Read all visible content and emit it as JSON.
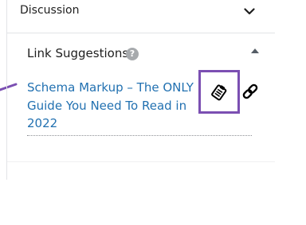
{
  "discussion": {
    "title": "Discussion",
    "chevron_icon": "chevron-down-icon"
  },
  "link_suggestions": {
    "title": "Link Suggestions",
    "help_glyph": "?",
    "collapse_icon": "triangle-up-icon",
    "items": [
      {
        "title": "Schema Markup – The ONLY Guide You Need To Read in 2022",
        "copy_icon": "clipboard-icon",
        "link_icon": "link-icon"
      }
    ]
  },
  "colors": {
    "link": "#2271b1",
    "highlight": "#7b4fb2",
    "text": "#1e1e1e"
  }
}
